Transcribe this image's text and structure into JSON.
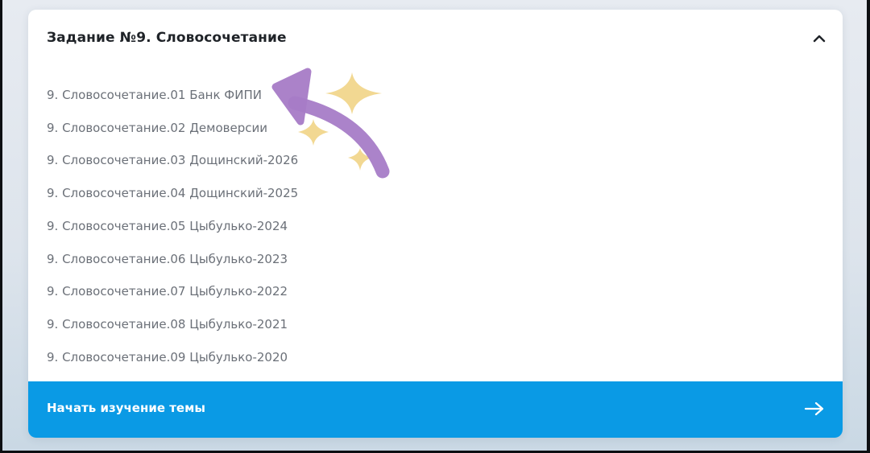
{
  "card": {
    "title": "Задание №9. Словосочетание",
    "expanded_icon": "chevron-up-icon"
  },
  "topics": [
    "9. Словосочетание.01 Банк ФИПИ",
    "9. Словосочетание.02 Демоверсии",
    "9. Словосочетание.03 Дощинский-2026",
    "9. Словосочетание.04 Дощинский-2025",
    "9. Словосочетание.05 Цыбулько-2024",
    "9. Словосочетание.06 Цыбулько-2023",
    "9. Словосочетание.07 Цыбулько-2022",
    "9. Словосочетание.08 Цыбулько-2021",
    "9. Словосочетание.09 Цыбулько-2020"
  ],
  "cta": {
    "label": "Начать изучение темы",
    "icon": "arrow-right-icon"
  },
  "colors": {
    "accent": "#0a9ae5",
    "title": "#1f2328",
    "list_text": "#6b7078",
    "overlay_arrow": "#a77cc7",
    "overlay_sparkle": "#efd07a"
  },
  "overlay": {
    "icons": [
      "curved-arrow-icon",
      "sparkle-icon"
    ]
  }
}
